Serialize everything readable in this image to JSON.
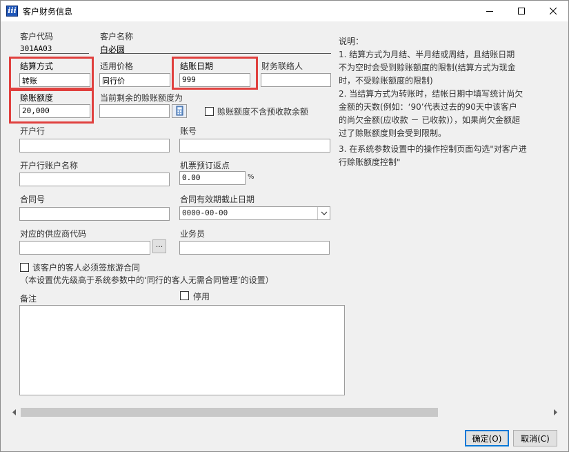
{
  "window": {
    "title": "客户财务信息"
  },
  "customer": {
    "code_label": "客户代码",
    "code_value": "301AA03",
    "name_label": "客户名称",
    "name_value": "白必圆"
  },
  "settlement": {
    "method_label": "结算方式",
    "method_value": "转账",
    "price_label": "适用价格",
    "price_value": "同行价",
    "date_label": "结账日期",
    "date_value": "999",
    "contact_label": "财务联络人",
    "contact_value": ""
  },
  "credit": {
    "limit_label": "赊账额度",
    "limit_value": "20,000",
    "remaining_label": "当前剩余的赊账额度为",
    "remaining_value": "",
    "exclude_prepay_label": "赊账额度不含预收款余额",
    "exclude_prepay_checked": false
  },
  "bank": {
    "bank_label": "开户行",
    "bank_value": "",
    "account_label": "账号",
    "account_value": "",
    "account_name_label": "开户行账户名称",
    "account_name_value": "",
    "rebate_label": "机票预订返点",
    "rebate_value": "0.00",
    "rebate_unit": "%"
  },
  "contract": {
    "number_label": "合同号",
    "number_value": "",
    "expiry_label": "合同有效期截止日期",
    "expiry_value": "0000-00-00"
  },
  "supplier": {
    "code_label": "对应的供应商代码",
    "code_value": "",
    "browse_label": "...",
    "salesperson_label": "业务员",
    "salesperson_value": ""
  },
  "tour_contract": {
    "label": "该客户的客人必须签旅游合同",
    "checked": false,
    "note": "（本设置优先级高于系统参数中的‘同行的客人无需合同管理’的设置）"
  },
  "remarks": {
    "label": "备注",
    "value": ""
  },
  "disable": {
    "label": "停用",
    "checked": false
  },
  "notes": {
    "title": "说明：",
    "lines": [
      "1. 结算方式为月结、半月结或周结，且结账日期",
      "不为空时会受到赊账额度的限制(结算方式为现金",
      "时，不受赊账额度的限制)",
      "2. 当结算方式为转账时，结帐日期中填写统计尚欠",
      "金额的天数(例如：‘90’代表过去的90天中该客户",
      "的尚欠金额(应收款 － 已收款)），如果尚欠金额超",
      "过了赊账额度则会受到限制。",
      "3. 在系统参数设置中的操作控制页面勾选\"对客户进",
      "行赊账额度控制\""
    ]
  },
  "buttons": {
    "ok": "确定(O)",
    "cancel": "取消(C)"
  },
  "colors": {
    "highlight": "#e0403e",
    "accent": "#0078d7"
  }
}
